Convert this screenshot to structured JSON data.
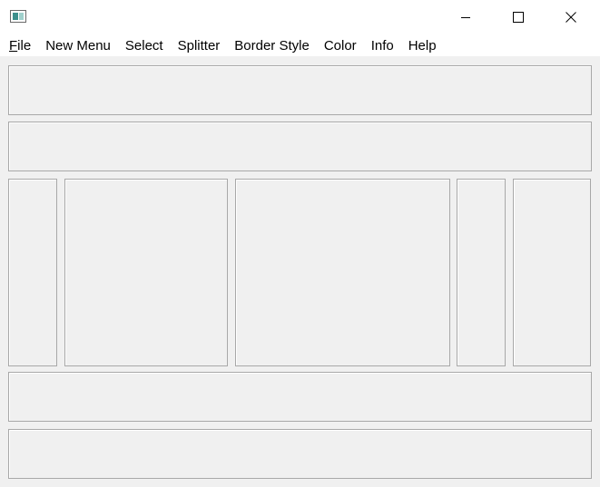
{
  "window": {
    "title": "",
    "icon": "app-window-icon",
    "controls": {
      "minimize_icon": "minimize-icon",
      "maximize_icon": "maximize-icon",
      "close_icon": "close-icon"
    }
  },
  "menu": {
    "items": [
      {
        "id": "file",
        "label": "File",
        "accelerator_index": 0
      },
      {
        "id": "new-menu",
        "label": "New Menu"
      },
      {
        "id": "select",
        "label": "Select"
      },
      {
        "id": "splitter",
        "label": "Splitter"
      },
      {
        "id": "border-style",
        "label": "Border Style"
      },
      {
        "id": "color",
        "label": "Color"
      },
      {
        "id": "info",
        "label": "Info"
      },
      {
        "id": "help",
        "label": "Help"
      }
    ]
  },
  "colors": {
    "panel_background": "#f0f0f0",
    "panel_border": "#a8a8a8",
    "titlebar_background": "#ffffff"
  }
}
